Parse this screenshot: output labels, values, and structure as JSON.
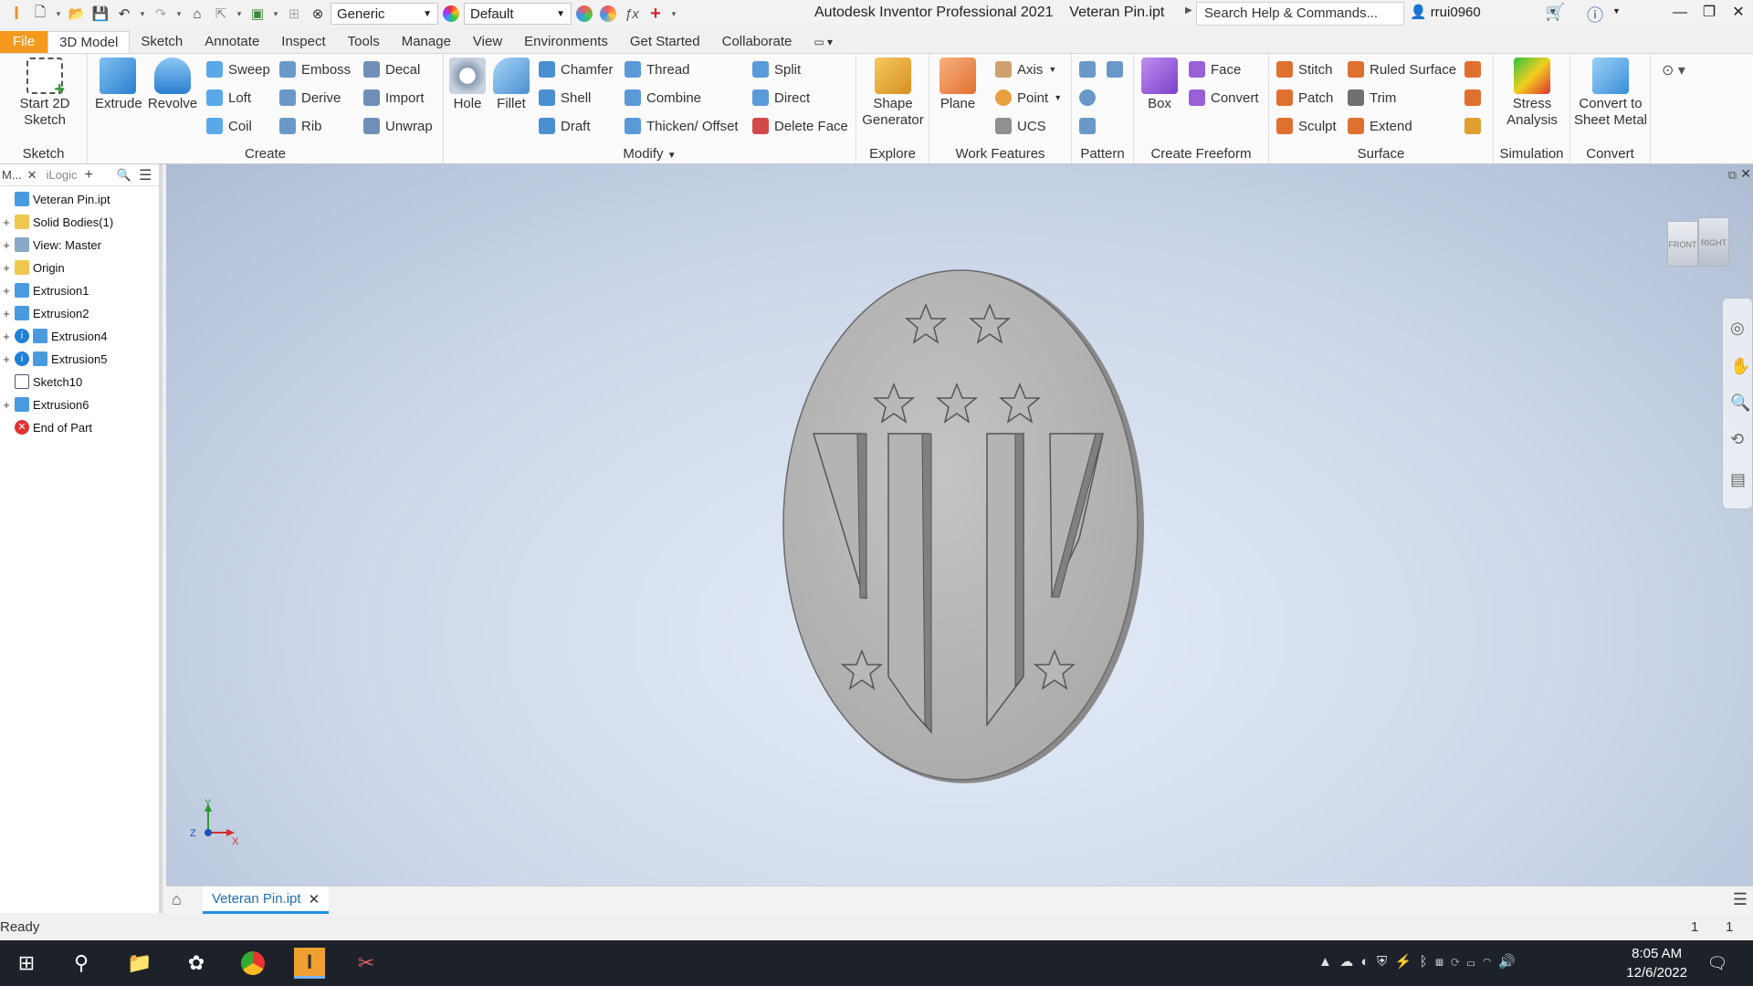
{
  "titlebar": {
    "appearance_select": "Generic",
    "material_select": "Default",
    "app_title": "Autodesk Inventor Professional 2021",
    "doc_title": "Veteran Pin.ipt",
    "search_placeholder": "Search Help & Commands...",
    "username": "rrui0960"
  },
  "tabs": [
    "File",
    "3D Model",
    "Sketch",
    "Annotate",
    "Inspect",
    "Tools",
    "Manage",
    "View",
    "Environments",
    "Get Started",
    "Collaborate"
  ],
  "ribbon": {
    "sketch": {
      "title": "Sketch",
      "start": "Start 2D Sketch"
    },
    "create": {
      "title": "Create",
      "extrude": "Extrude",
      "revolve": "Revolve",
      "col1": [
        "Sweep",
        "Loft",
        "Coil"
      ],
      "col2": [
        "Emboss",
        "Derive",
        "Rib"
      ],
      "col3": [
        "Decal",
        "Import",
        "Unwrap"
      ]
    },
    "modify": {
      "title": "Modify",
      "hole": "Hole",
      "fillet": "Fillet",
      "col1": [
        "Chamfer",
        "Shell",
        "Draft"
      ],
      "col2": [
        "Thread",
        "Combine",
        "Thicken/ Offset"
      ],
      "col3": [
        "Split",
        "Direct",
        "Delete Face"
      ]
    },
    "explore": {
      "title": "Explore",
      "shape_gen": "Shape Generator"
    },
    "work": {
      "title": "Work Features",
      "plane": "Plane",
      "items": [
        "Axis",
        "Point",
        "UCS"
      ]
    },
    "pattern": {
      "title": "Pattern"
    },
    "freeform": {
      "title": "Create Freeform",
      "box": "Box",
      "items": [
        "Face",
        "Convert"
      ]
    },
    "surface": {
      "title": "Surface",
      "col1": [
        "Stitch",
        "Patch",
        "Sculpt"
      ],
      "col2": [
        "Ruled Surface",
        "Trim",
        "Extend"
      ]
    },
    "simulation": {
      "title": "Simulation",
      "stress": "Stress Analysis"
    },
    "convert": {
      "title": "Convert",
      "sheet": "Convert to Sheet Metal"
    }
  },
  "browser": {
    "tab1": "M...",
    "tab2": "iLogic",
    "items": [
      "Veteran Pin.ipt",
      "Solid Bodies(1)",
      "View: Master",
      "Origin",
      "Extrusion1",
      "Extrusion2",
      "Extrusion4",
      "Extrusion5",
      "Sketch10",
      "Extrusion6",
      "End of Part"
    ]
  },
  "viewcube": {
    "front": "FRONT",
    "right": "RIGHT"
  },
  "axes": {
    "y": "Y",
    "z": "Z",
    "x": "X"
  },
  "doc_tab": "Veteran Pin.ipt",
  "status": {
    "text": "Ready",
    "n1": "1",
    "n2": "1"
  },
  "taskbar": {
    "time": "8:05 AM",
    "date": "12/6/2022"
  },
  "colors": {
    "file_tab": "#f59a1d",
    "accent": "#1f8fe0",
    "taskbar": "#1d2129"
  }
}
